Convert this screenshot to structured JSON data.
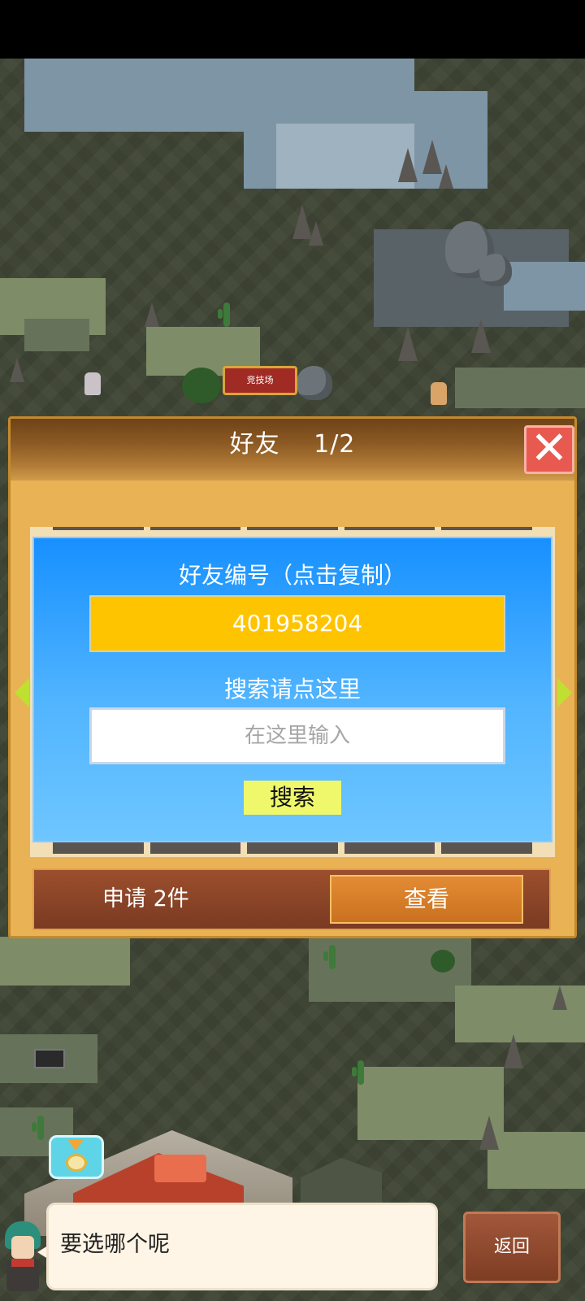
{
  "map": {
    "arena_sign": "竞技场"
  },
  "friend_dialog": {
    "title": "好友　 1/2",
    "friend_id_label": "好友编号（点击复制）",
    "friend_id": "401958204",
    "search_label": "搜索请点这里",
    "search_placeholder": "在这里输入",
    "search_button": "搜索",
    "requests_label": "申请 2件",
    "view_button": "查看"
  },
  "bottom": {
    "dialogue": "要选哪个呢",
    "back_button": "返回"
  },
  "colors": {
    "dialog_frame": "#e9b355",
    "card_blue": "#1790ff",
    "friend_id_bg": "#ffc400",
    "search_button_bg": "#eef86a",
    "view_button_bg": "#e38b34",
    "close_button_bg": "#e85a50"
  },
  "icons": [
    "close-icon",
    "left-arrow-icon",
    "right-arrow-icon",
    "build-marker-icon"
  ]
}
